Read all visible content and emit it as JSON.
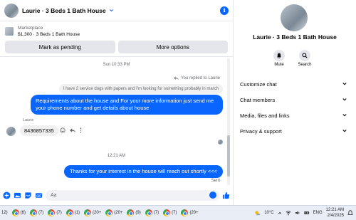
{
  "chat": {
    "title": "Laurie · 3 Beds 1 Bath House",
    "info_icon": "ℹ"
  },
  "listing": {
    "source": "Marketplace",
    "title": "$1,300 · 3 Beds 1 Bath House",
    "mark_pending": "Mark as pending",
    "more_options": "More options"
  },
  "messages": {
    "timestamp1": "Sun 10:33 PM",
    "replied_note": "You replied to Laurie",
    "quoted_text": "I have 2 service dogs with papers and I'm looking for something probably in march",
    "outgoing1": "Requirements about the house and For  your  more  information  just  send  me   your  phone  number  and  get details about house",
    "sender_name": "Laurie",
    "incoming1": "8436857335",
    "timestamp2": "12:21 AM",
    "outgoing2": "Thanks for your interest in the house will reach out shortly  <<<",
    "status": "Sent"
  },
  "composer": {
    "placeholder": "Aa"
  },
  "side": {
    "name": "Laurie · 3 Beds 1 Bath House",
    "mute": "Mute",
    "search": "Search",
    "sections": [
      "Customize chat",
      "Chat members",
      "Media, files and links",
      "Privacy & support"
    ]
  },
  "taskbar": {
    "items": [
      "12)",
      "(6)",
      "(7)",
      "(7)",
      "(1)",
      "(20+",
      "(20+",
      "(9)",
      "(7)",
      "(7)",
      "(20+"
    ],
    "weather": "10°C",
    "lang": "ENG",
    "time": "12:21 AM",
    "date": "2/4/2025"
  },
  "colors": {
    "accent": "#0866ff",
    "bubble_in": "#f0f0f0",
    "button_bg": "#e4e6eb"
  }
}
